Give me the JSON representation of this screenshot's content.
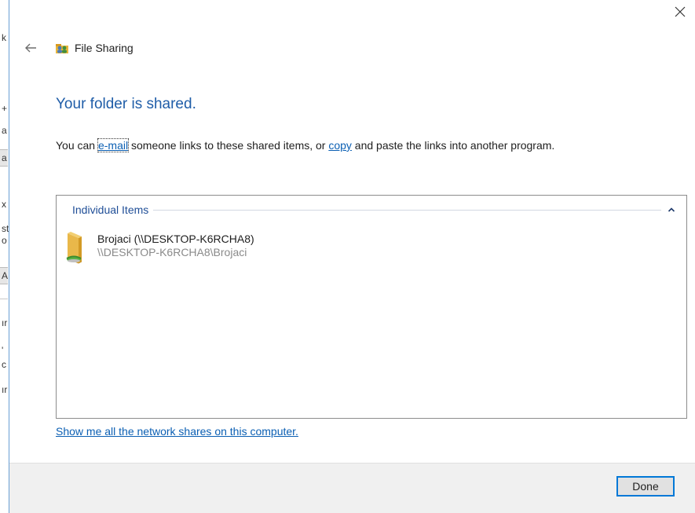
{
  "background_window": {
    "fragments": [
      "k",
      "+",
      "a",
      "a",
      "x",
      "st",
      "o",
      "A",
      "ır",
      "'",
      "c",
      "ır"
    ]
  },
  "dialog": {
    "title": "File Sharing",
    "icons": {
      "close": "close-icon",
      "back": "back-arrow-icon",
      "title": "file-sharing-icon",
      "folder": "shared-folder-icon",
      "collapse": "chevron-up-icon"
    },
    "heading": "Your folder is shared.",
    "instructions": {
      "prefix": "You can ",
      "email_link": "e-mail",
      "middle": " someone links to these shared items, or ",
      "copy_link": "copy",
      "suffix": " and paste the links into another program."
    },
    "items_group": {
      "label": "Individual Items",
      "items": [
        {
          "name": "Brojaci (\\\\DESKTOP-K6RCHA8)",
          "path": "\\\\DESKTOP-K6RCHA8\\Brojaci"
        }
      ]
    },
    "network_shares_link": "Show me all the network shares on this computer.",
    "done_label": "Done"
  },
  "colors": {
    "heading": "#1f5da8",
    "link": "#0b5fb3",
    "group_label": "#1f4e97",
    "button_focus": "#0078d7",
    "footer_bg": "#f0f0f0"
  }
}
